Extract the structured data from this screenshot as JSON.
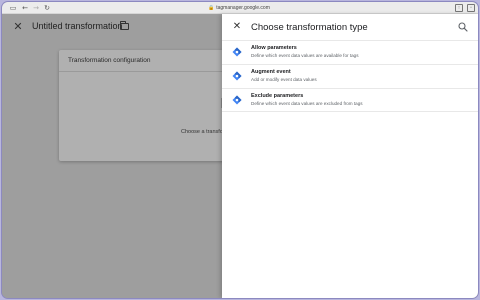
{
  "browser": {
    "url": "tagmanager.google.com"
  },
  "page": {
    "title": "Untitled transformation",
    "config_card": {
      "title": "Transformation configuration",
      "hint": "Choose a transfo"
    }
  },
  "panel": {
    "title": "Choose transformation type",
    "options": [
      {
        "name": "Allow parameters",
        "description": "Define which event data values are available for tags",
        "icon": "tag-icon"
      },
      {
        "name": "Augment event",
        "description": "Add or modify event data values",
        "icon": "tag-icon"
      },
      {
        "name": "Exclude parameters",
        "description": "Define which event data values are excluded from tags",
        "icon": "tag-icon"
      }
    ]
  },
  "colors": {
    "accent": "#4285f4",
    "overlay": "#9e9e9e",
    "panel": "#ffffff",
    "desktop": "#b9b6de"
  }
}
